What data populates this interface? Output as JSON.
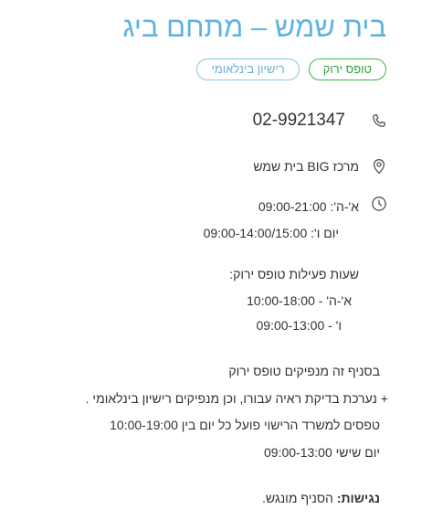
{
  "branch": {
    "title": "בית שמש – מתחם ביג",
    "tags": {
      "green_form": "טופס ירוק",
      "intl_license": "רישיון בינלאומי"
    },
    "phone": "02-9921347",
    "address": "מרכז BIG בית שמש",
    "hours": {
      "line1": "א'-ה': 09:00-21:00",
      "line2": "יום ו': 09:00-14:00/15:00"
    },
    "green_form_hours": {
      "heading": "שעות פעילות טופס ירוק:",
      "line1": "א'-ה' - 10:00-18:00",
      "line2": "ו' - 09:00-13:00"
    },
    "notes": {
      "line1": "בסניף זה מנפיקים טופס ירוק",
      "line2": "+ נערכת בדיקת ראיה עבורו, וכן מנפיקים רישיון בינלאומי .",
      "line3": "טפסים למשרד הרישוי פועל כל יום בין 10:00-19:00",
      "line4": "יום שישי 09:00-13:00"
    },
    "accessibility": {
      "label": "נגישות:",
      "value": "הסניף מונגש."
    }
  },
  "icons": {
    "phone": "phone-icon",
    "location": "location-pin-icon",
    "clock": "clock-icon"
  },
  "colors": {
    "title": "#5eb4e0",
    "green_tag": "#3cb44b",
    "blue_tag": "#87c6e6"
  }
}
